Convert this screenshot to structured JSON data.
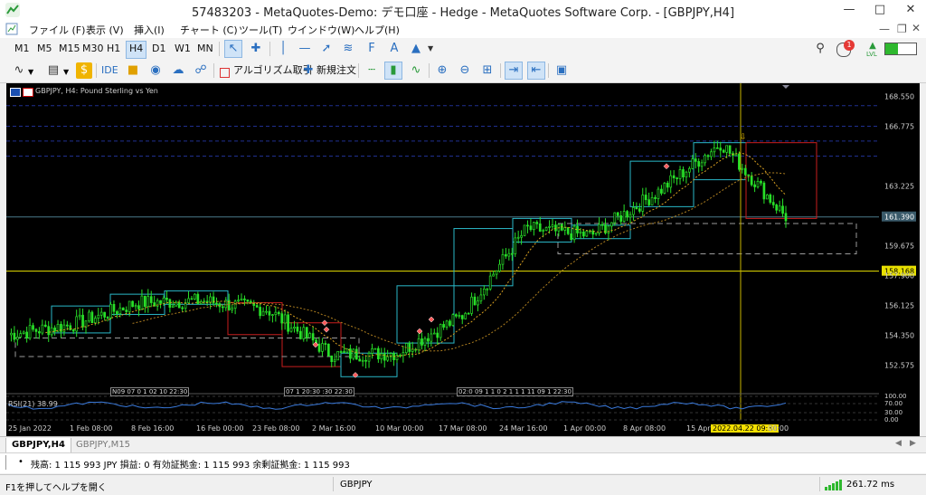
{
  "window": {
    "title": "57483203 - MetaQuotes-Demo: デモ口座 - Hedge - MetaQuotes Software Corp. - [GBPJPY,H4]"
  },
  "menu": [
    "ファイル (F)",
    "表示 (V)",
    "挿入(I)",
    "チャート (C)",
    "ツール(T)",
    "ウインドウ(W)",
    "ヘルプ(H)"
  ],
  "timeframes": [
    "M1",
    "M5",
    "M15",
    "M30",
    "H1",
    "H4",
    "D1",
    "W1",
    "MN"
  ],
  "active_timeframe": "H4",
  "toolbar2": {
    "ide": "IDE",
    "algo": "アルゴリズム取引",
    "neworder": "新規注文"
  },
  "notifications": {
    "count": "1",
    "signal_label": "LVL"
  },
  "chart": {
    "symbol_desc": "GBPJPY, H4:  Pound Sterling vs Yen",
    "price_labels": [
      "168.550",
      "166.775",
      "163.225",
      "161.390",
      "159.675",
      "158.168",
      "157.900",
      "156.125",
      "154.350",
      "152.575"
    ],
    "current_price": "161.390",
    "hline_price": "158.168",
    "time_labels": [
      "25 Jan 2022",
      "1 Feb 08:00",
      "8 Feb 16:00",
      "16 Feb 00:00",
      "23 Feb 08:00",
      "2 Mar 16:00",
      "10 Mar 00:00",
      "17 Mar 08:00",
      "24 Mar 16:00",
      "1 Apr 00:00",
      "8 Apr 08:00",
      "15 Apr 16:00"
    ],
    "crosshair_time": "2022.04.22 09:30",
    "crosshair_tail": "00:00",
    "rsi_label": "RSI(21) 38.99",
    "rsi_levels": [
      "100.00",
      "70.00",
      "30.00",
      "0.00"
    ],
    "event_strip_1": "N09 07 0 1 02 10 22:30",
    "event_strip_2": "07 1 20:30 :30 22:30",
    "event_strip_3": "02:0 09 1 1 0 2 1 1 1 11 09 1 22:30"
  },
  "chart_data": {
    "type": "line",
    "title": "GBPJPY, H4:  Pound Sterling vs Yen",
    "x": [
      "25 Jan 2022",
      "1 Feb 08:00",
      "8 Feb 16:00",
      "16 Feb 00:00",
      "23 Feb 08:00",
      "2 Mar 16:00",
      "10 Mar 00:00",
      "17 Mar 08:00",
      "24 Mar 16:00",
      "1 Apr 00:00",
      "8 Apr 08:00",
      "15 Apr 16:00",
      "22 Apr 09:30"
    ],
    "series": [
      {
        "values": [
          154.4,
          155.0,
          156.3,
          156.4,
          155.9,
          153.2,
          153.3,
          155.5,
          160.7,
          160.3,
          162.8,
          165.8,
          161.4
        ]
      }
    ],
    "ylim": [
      151.7,
      168.9
    ]
  },
  "tabs": [
    "GBPJPY,H4",
    "GBPJPY,M15"
  ],
  "account": {
    "text": "残高: 1 115 993 JPY  損益: 0  有効証拠金: 1 115 993  余剰証拠金: 1 115 993"
  },
  "status": {
    "help": "F1を押してヘルプを開く",
    "symbol": "GBPJPY",
    "ping": "261.72 ms"
  }
}
